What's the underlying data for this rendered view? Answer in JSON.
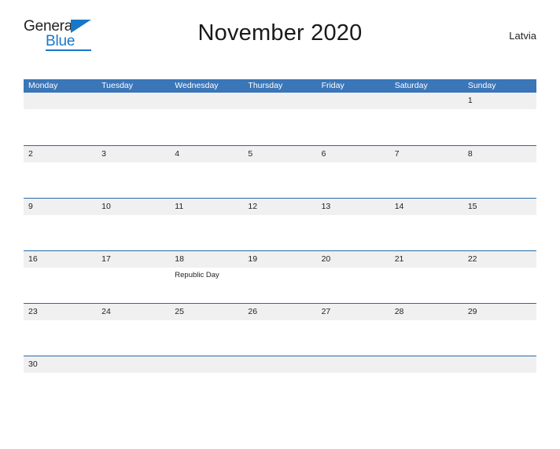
{
  "brand": {
    "name_part1": "General",
    "name_part2": "Blue",
    "triangle_icon": "triangle-icon"
  },
  "header": {
    "title": "November 2020",
    "region": "Latvia"
  },
  "colors": {
    "header_blue": "#3a76b8",
    "rule_blue": "#2a6aa8",
    "band_gray": "#f0f0f0",
    "brand_blue": "#1877c9",
    "text_dark": "#231f20"
  },
  "calendar": {
    "month": "November",
    "year": "2020",
    "weekday_headers": [
      "Monday",
      "Tuesday",
      "Wednesday",
      "Thursday",
      "Friday",
      "Saturday",
      "Sunday"
    ],
    "weeks": [
      [
        {
          "num": "",
          "event": ""
        },
        {
          "num": "",
          "event": ""
        },
        {
          "num": "",
          "event": ""
        },
        {
          "num": "",
          "event": ""
        },
        {
          "num": "",
          "event": ""
        },
        {
          "num": "",
          "event": ""
        },
        {
          "num": "1",
          "event": ""
        }
      ],
      [
        {
          "num": "2",
          "event": ""
        },
        {
          "num": "3",
          "event": ""
        },
        {
          "num": "4",
          "event": ""
        },
        {
          "num": "5",
          "event": ""
        },
        {
          "num": "6",
          "event": ""
        },
        {
          "num": "7",
          "event": ""
        },
        {
          "num": "8",
          "event": ""
        }
      ],
      [
        {
          "num": "9",
          "event": ""
        },
        {
          "num": "10",
          "event": ""
        },
        {
          "num": "11",
          "event": ""
        },
        {
          "num": "12",
          "event": ""
        },
        {
          "num": "13",
          "event": ""
        },
        {
          "num": "14",
          "event": ""
        },
        {
          "num": "15",
          "event": ""
        }
      ],
      [
        {
          "num": "16",
          "event": ""
        },
        {
          "num": "17",
          "event": ""
        },
        {
          "num": "18",
          "event": "Republic Day"
        },
        {
          "num": "19",
          "event": ""
        },
        {
          "num": "20",
          "event": ""
        },
        {
          "num": "21",
          "event": ""
        },
        {
          "num": "22",
          "event": ""
        }
      ],
      [
        {
          "num": "23",
          "event": ""
        },
        {
          "num": "24",
          "event": ""
        },
        {
          "num": "25",
          "event": ""
        },
        {
          "num": "26",
          "event": ""
        },
        {
          "num": "27",
          "event": ""
        },
        {
          "num": "28",
          "event": ""
        },
        {
          "num": "29",
          "event": ""
        }
      ],
      [
        {
          "num": "30",
          "event": ""
        },
        {
          "num": "",
          "event": ""
        },
        {
          "num": "",
          "event": ""
        },
        {
          "num": "",
          "event": ""
        },
        {
          "num": "",
          "event": ""
        },
        {
          "num": "",
          "event": ""
        },
        {
          "num": "",
          "event": ""
        }
      ]
    ]
  }
}
